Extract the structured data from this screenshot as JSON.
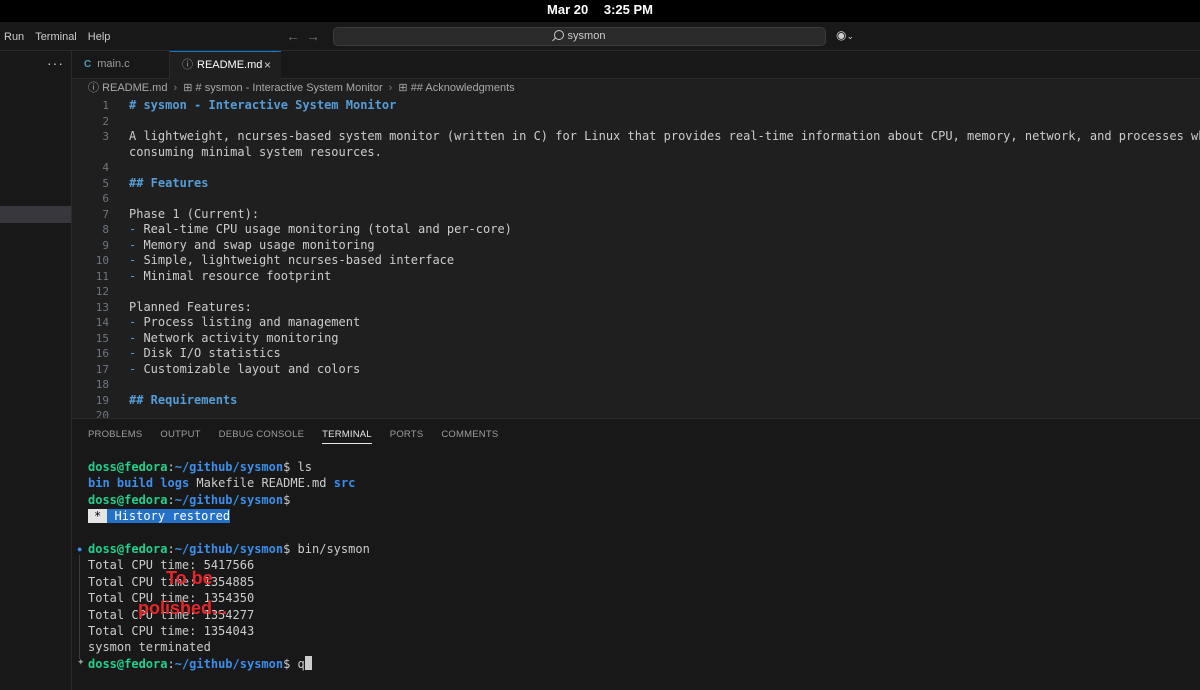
{
  "system_bar": {
    "date": "Mar 20",
    "time": "3:25 PM"
  },
  "menu": {
    "items": [
      "Run",
      "Terminal",
      "Help"
    ]
  },
  "search": {
    "text": "sysmon"
  },
  "tabs": [
    {
      "label": "main.c",
      "icon": "c-file-icon"
    },
    {
      "label": "README.md",
      "icon": "info-icon"
    }
  ],
  "breadcrumb": {
    "file": "README.md",
    "heading1": "# sysmon - Interactive System Monitor",
    "heading2": "## Acknowledgments"
  },
  "editor": {
    "lines": [
      {
        "n": "1",
        "text": "# sysmon - Interactive System Monitor",
        "kind": "heading"
      },
      {
        "n": "2",
        "text": "",
        "kind": "plain"
      },
      {
        "n": "3",
        "text": "A lightweight, ncurses-based system monitor (written in C) for Linux that provides real-time information about CPU, memory, network, and processes while",
        "kind": "plain"
      },
      {
        "n": "",
        "text": "consuming minimal system resources.",
        "kind": "plain"
      },
      {
        "n": "4",
        "text": "",
        "kind": "plain"
      },
      {
        "n": "5",
        "text": "## Features",
        "kind": "heading"
      },
      {
        "n": "6",
        "text": "",
        "kind": "plain"
      },
      {
        "n": "7",
        "text": "Phase 1 (Current):",
        "kind": "plain"
      },
      {
        "n": "8",
        "text": "Real-time CPU usage monitoring (total and per-core)",
        "kind": "bullet"
      },
      {
        "n": "9",
        "text": "Memory and swap usage monitoring",
        "kind": "bullet"
      },
      {
        "n": "10",
        "text": "Simple, lightweight ncurses-based interface",
        "kind": "bullet"
      },
      {
        "n": "11",
        "text": "Minimal resource footprint",
        "kind": "bullet"
      },
      {
        "n": "12",
        "text": "",
        "kind": "plain"
      },
      {
        "n": "13",
        "text": "Planned Features:",
        "kind": "plain"
      },
      {
        "n": "14",
        "text": "Process listing and management",
        "kind": "bullet"
      },
      {
        "n": "15",
        "text": "Network activity monitoring",
        "kind": "bullet"
      },
      {
        "n": "16",
        "text": "Disk I/O statistics",
        "kind": "bullet"
      },
      {
        "n": "17",
        "text": "Customizable layout and colors",
        "kind": "bullet"
      },
      {
        "n": "18",
        "text": "",
        "kind": "plain"
      },
      {
        "n": "19",
        "text": "## Requirements",
        "kind": "heading"
      },
      {
        "n": "20",
        "text": "",
        "kind": "plain"
      }
    ]
  },
  "panel": {
    "tabs": [
      "PROBLEMS",
      "OUTPUT",
      "DEBUG CONSOLE",
      "TERMINAL",
      "PORTS",
      "COMMENTS"
    ],
    "active_tab": "TERMINAL"
  },
  "terminal": {
    "user_host": "doss@fedora",
    "path": "~/github/sysmon",
    "cmd_ls": "ls",
    "ls_dirs_1": [
      "bin",
      "build",
      "logs"
    ],
    "ls_files": [
      "Makefile",
      "README.md"
    ],
    "ls_dirs_2": [
      "src"
    ],
    "history_star": "*",
    "history_text": "History restored",
    "cmd_run": "bin/sysmon",
    "output": [
      "Total CPU time: 5417566",
      "Total CPU time: 1354885",
      "Total CPU time: 1354350",
      "Total CPU time: 1354277",
      "Total CPU time: 1354043",
      "sysmon terminated"
    ],
    "last_input": "q"
  },
  "annotation": {
    "line1": "To be",
    "line2": "polished..."
  },
  "colors": {
    "accent": "#0078d4",
    "heading": "#569cd6",
    "prompt_user": "#23d18b",
    "prompt_path": "#3b8eea",
    "annotation": "#e8262b"
  }
}
